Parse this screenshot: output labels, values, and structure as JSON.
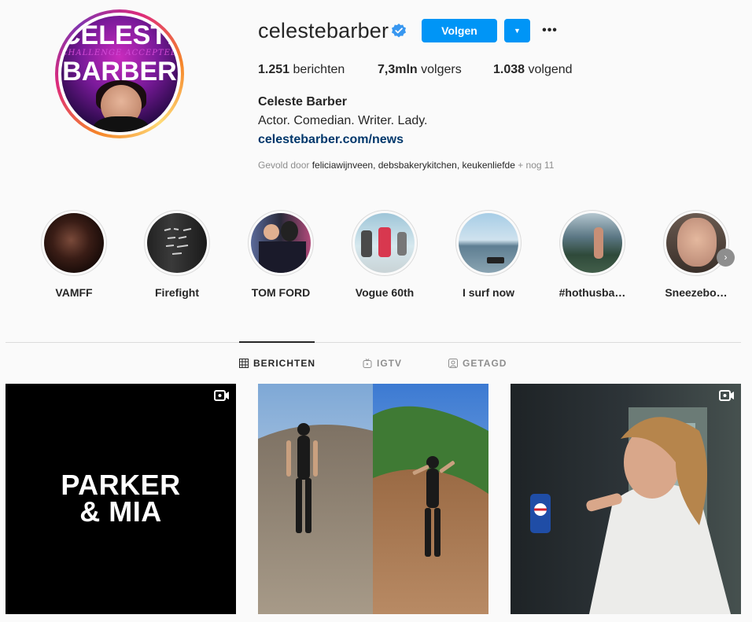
{
  "profile": {
    "avatar_text_top": "CELESTE",
    "avatar_text_mid": "CHALLENGE ACCEPTED",
    "avatar_text_bottom": "BARBER",
    "username": "celestebarber",
    "follow_label": "Volgen",
    "posts_count": "1.251",
    "posts_label": " berichten",
    "followers_count": "7,3mln",
    "followers_label": " volgers",
    "following_count": "1.038",
    "following_label": " volgend",
    "full_name": "Celeste Barber",
    "bio": "Actor. Comedian. Writer. Lady.",
    "link": "celestebarber.com/news",
    "followed_by_prefix": "Gevold door ",
    "followed_by_users": "feliciawijnveen, debsbakerykitchen, keukenliefde",
    "followed_by_more": " + nog 11",
    "verified_color": "#3897f0",
    "accent_color": "#0095f6"
  },
  "highlights": [
    {
      "label": "VAMFF",
      "icon": "highlight-thumbnail"
    },
    {
      "label": "Firefight",
      "icon": "highlight-thumbnail"
    },
    {
      "label": "TOM FORD",
      "icon": "highlight-thumbnail"
    },
    {
      "label": "Vogue 60th",
      "icon": "highlight-thumbnail"
    },
    {
      "label": "I surf now",
      "icon": "highlight-thumbnail"
    },
    {
      "label": "#hothusba…",
      "icon": "highlight-thumbnail"
    },
    {
      "label": "Sneezebo…",
      "icon": "highlight-thumbnail"
    }
  ],
  "tabs": [
    {
      "label": "BERICHTEN",
      "icon": "grid-icon",
      "active": true
    },
    {
      "label": "IGTV",
      "icon": "igtv-icon",
      "active": false
    },
    {
      "label": "GETAGD",
      "icon": "tagged-icon",
      "active": false
    }
  ],
  "posts": [
    {
      "text_line1": "PARKER",
      "text_line2": "& MIA",
      "type": "video"
    },
    {
      "type": "image"
    },
    {
      "type": "video"
    }
  ]
}
